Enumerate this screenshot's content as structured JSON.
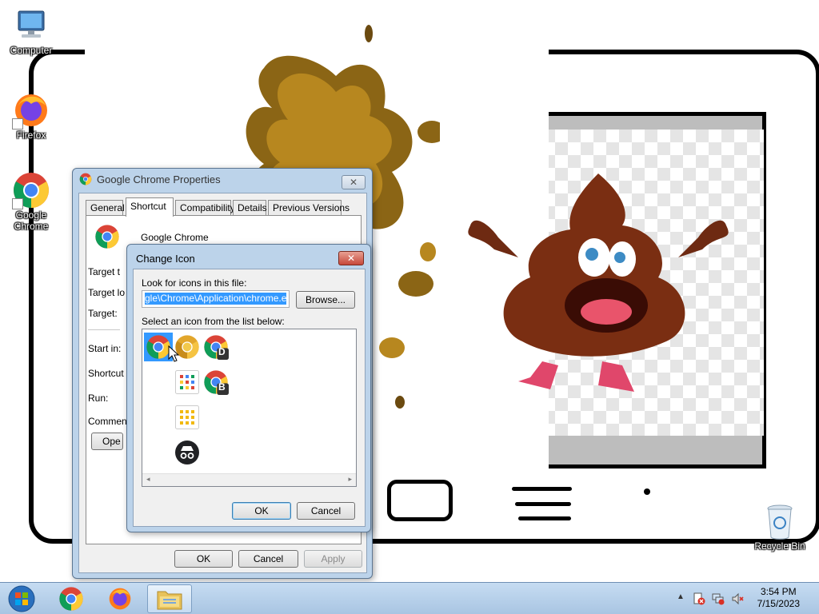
{
  "desktop": {
    "icons": [
      {
        "label": "Computer",
        "icon": "computer-icon"
      },
      {
        "label": "Firefox",
        "icon": "firefox-icon"
      },
      {
        "label": "Google Chrome",
        "icon": "chrome-icon"
      },
      {
        "label": "Recycle Bin",
        "icon": "recycle-bin-icon"
      }
    ]
  },
  "properties": {
    "title": "Google Chrome Properties",
    "tabs": [
      "General",
      "Shortcut",
      "Compatibility",
      "Details",
      "Previous Versions"
    ],
    "active_tab": "Shortcut",
    "app_name": "Google Chrome",
    "field_labels": [
      "Target t",
      "Target lo",
      "Target:",
      "Start in:",
      "Shortcut",
      "Run:",
      "Commen"
    ],
    "open_button": "Ope",
    "ok": "OK",
    "cancel": "Cancel",
    "apply": "Apply"
  },
  "change_icon": {
    "title": "Change Icon",
    "look_label": "Look for icons in this file:",
    "file_path": "gle\\Chrome\\Application\\chrome.exe",
    "browse": "Browse...",
    "select_label": "Select an icon from the list below:",
    "icons": [
      "chrome",
      "chrome-canary",
      "chrome-dev",
      "apps-grid",
      "chrome-beta",
      "apps-grid-yellow",
      "incognito"
    ],
    "badge_dev": "D",
    "badge_beta": "B",
    "ok": "OK",
    "cancel": "Cancel"
  },
  "taskbar": {
    "time": "3:54 PM",
    "date": "7/15/2023"
  },
  "colors": {
    "selection": "#3399ff",
    "close_red": "#c7483a",
    "title_bar": "#bcd3ea"
  }
}
